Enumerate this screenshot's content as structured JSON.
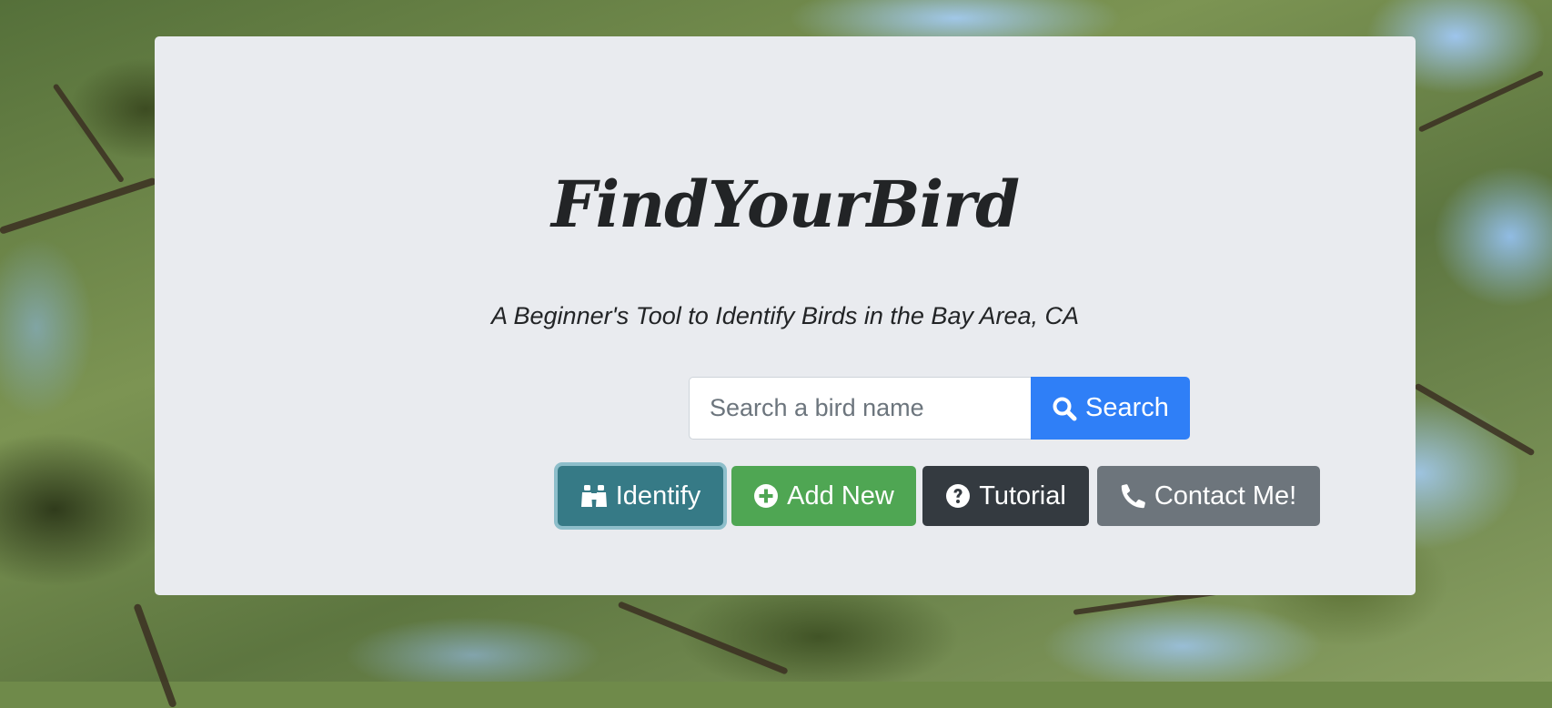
{
  "app": {
    "title": "FindYourBird",
    "subtitle": "A Beginner's Tool to Identify Birds in the Bay Area, CA"
  },
  "search": {
    "placeholder": "Search a bird name",
    "value": "",
    "button_label": "Search"
  },
  "actions": [
    {
      "label": "Identify",
      "icon": "binoculars-icon",
      "color": "#367a86"
    },
    {
      "label": "Add New",
      "icon": "plus-circle-icon",
      "color": "#4fa653"
    },
    {
      "label": "Tutorial",
      "icon": "question-circle-icon",
      "color": "#343a40"
    },
    {
      "label": "Contact Me!",
      "icon": "phone-icon",
      "color": "#6d757c"
    }
  ],
  "colors": {
    "card_background": "#e9ebef",
    "search_button": "#2f7ff7",
    "text": "#222426"
  }
}
